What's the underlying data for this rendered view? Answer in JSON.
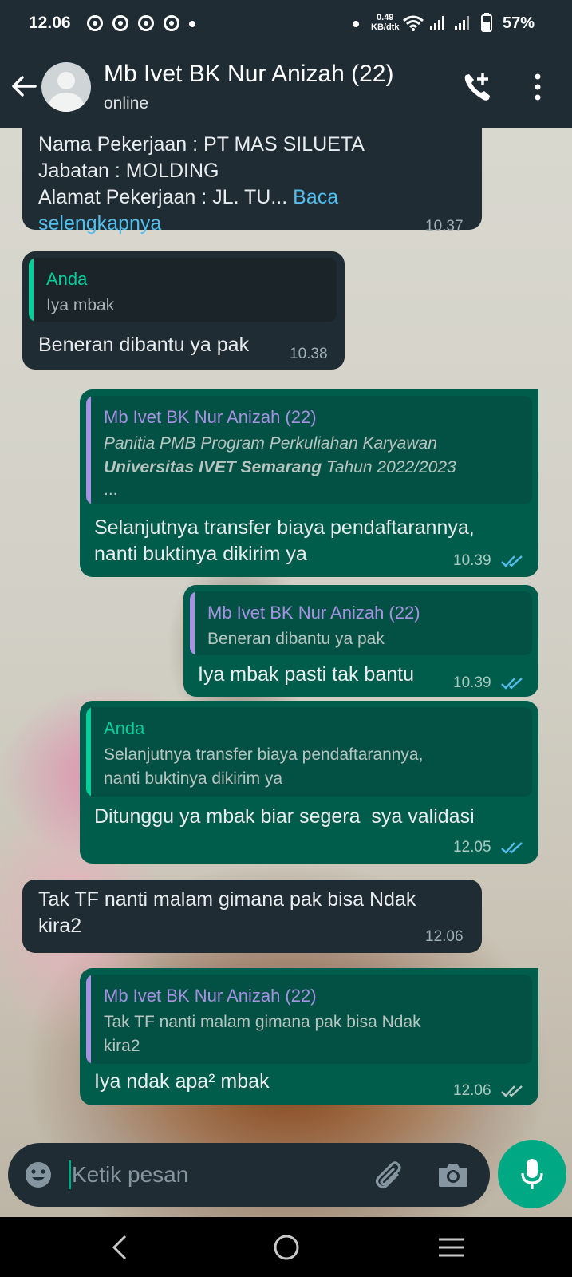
{
  "status_bar": {
    "time": "12.06",
    "net_speed_value": "0.49",
    "net_speed_unit": "KB/dtk",
    "battery": "57%"
  },
  "header": {
    "contact_name": "Mb Ivet BK Nur Anizah (22)",
    "contact_status": "online"
  },
  "messages": [
    {
      "direction": "incoming",
      "lines": [
        "Nama Pekerjaan : PT MAS SILUETA",
        "Jabatan : MOLDING",
        "Alamat Pekerjaan : JL. TU..."
      ],
      "read_more_1": "Baca",
      "read_more_2": "selengkapnya",
      "time": "10.37"
    },
    {
      "direction": "incoming",
      "quote_author": "Anda",
      "quote_text": "Iya mbak",
      "text": "Beneran dibantu ya pak",
      "time": "10.38"
    },
    {
      "direction": "outgoing",
      "quote_author": "Mb Ivet BK Nur Anizah (22)",
      "quote_line1": "Panitia PMB Program Perkuliahan Karyawan",
      "quote_line2_bold": "Universitas IVET Semarang",
      "quote_line2_rest": " Tahun 2022/2023",
      "quote_line3": "...",
      "text_line1": "Selanjutnya transfer biaya pendaftarannya,",
      "text_line2": "nanti buktinya dikirim ya",
      "time": "10.39",
      "status": "read"
    },
    {
      "direction": "outgoing",
      "quote_author": "Mb Ivet BK Nur Anizah (22)",
      "quote_text": "Beneran dibantu ya pak",
      "text": "Iya mbak pasti tak bantu",
      "time": "10.39",
      "status": "read"
    },
    {
      "direction": "outgoing",
      "quote_author": "Anda",
      "quote_line1": "Selanjutnya transfer biaya pendaftarannya,",
      "quote_line2": "nanti buktinya dikirim ya",
      "text": "Ditunggu ya mbak biar segera  sya validasi",
      "time": "12.05",
      "status": "read"
    },
    {
      "direction": "incoming",
      "text_line1": "Tak TF nanti malam gimana pak bisa Ndak",
      "text_line2": "kira2",
      "time": "12.06"
    },
    {
      "direction": "outgoing",
      "quote_author": "Mb Ivet BK Nur Anizah (22)",
      "quote_line1": "Tak TF nanti malam gimana pak bisa Ndak",
      "quote_line2": "kira2",
      "text": "Iya ndak apa² mbak",
      "time": "12.06",
      "status": "delivered"
    }
  ],
  "composer": {
    "placeholder": "Ketik pesan"
  },
  "icons": {
    "back": "arrow-left-icon",
    "call": "add-call-icon",
    "menu": "more-vert-icon",
    "emoji": "emoji-icon",
    "attach": "paperclip-icon",
    "camera": "camera-icon",
    "mic": "mic-icon"
  },
  "colors": {
    "header": "#1f2c34",
    "incoming_bubble": "#1f2c34",
    "outgoing_bubble": "#005c4b",
    "accent": "#00a884",
    "read_ticks": "#53bdeb",
    "quote_self": "#06cf9c",
    "quote_contact": "#a791e3"
  }
}
